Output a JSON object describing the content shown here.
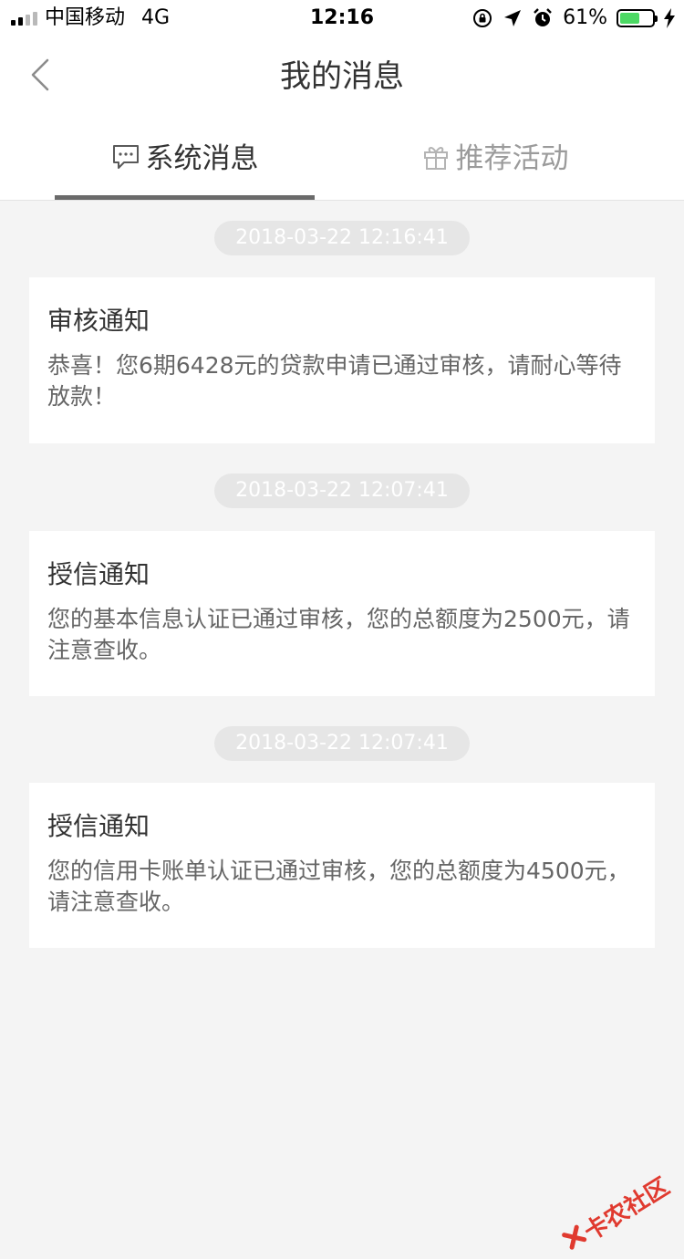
{
  "status_bar": {
    "carrier": "中国移动",
    "network": "4G",
    "time": "12:16",
    "battery_percent": "61%"
  },
  "nav": {
    "title": "我的消息"
  },
  "tabs": [
    {
      "label": "系统消息",
      "icon": "chat-bubble-icon",
      "active": true
    },
    {
      "label": "推荐活动",
      "icon": "gift-icon",
      "active": false
    }
  ],
  "messages": [
    {
      "time": "2018-03-22 12:16:41",
      "title": "审核通知",
      "body": "恭喜！您6期6428元的贷款申请已通过审核，请耐心等待放款！"
    },
    {
      "time": "2018-03-22 12:07:41",
      "title": "授信通知",
      "body": "您的基本信息认证已通过审核，您的总额度为2500元，请注意查收。"
    },
    {
      "time": "2018-03-22 12:07:41",
      "title": "授信通知",
      "body": "您的信用卡账单认证已通过审核，您的总额度为4500元，请注意查收。"
    }
  ],
  "watermark": {
    "text": "卡农社区"
  },
  "colors": {
    "background": "#f4f4f4",
    "battery_green": "#4cd964",
    "indicator": "#6a6a6a",
    "watermark_red": "#e03a2f"
  }
}
